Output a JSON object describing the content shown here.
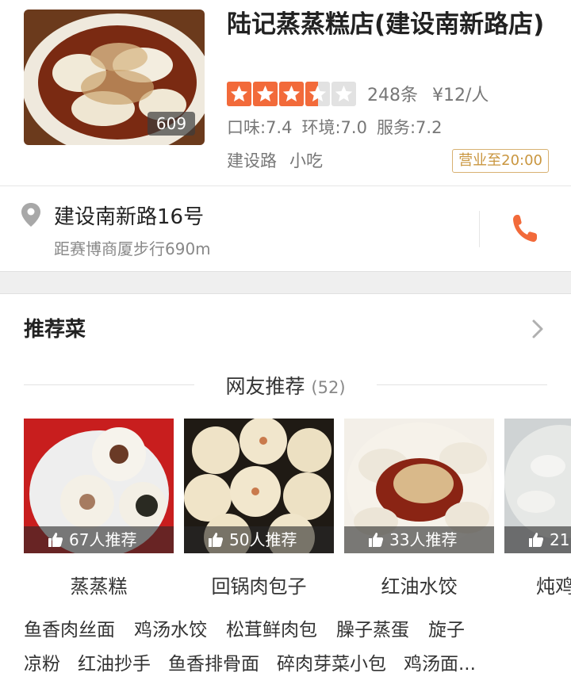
{
  "shop": {
    "name": "陆记蒸蒸糕店(建设南新路店)",
    "photo_count": "609",
    "rating": 3.5,
    "review_count": "248条",
    "avg_price": "¥12/人",
    "scores": [
      "口味:7.4",
      "环境:7.0",
      "服务:7.2"
    ],
    "tags": [
      "建设路",
      "小吃"
    ],
    "hours": "营业至20:00",
    "star_color": "#f26a3a"
  },
  "address": {
    "street": "建设南新路16号",
    "distance": "距赛博商厦步行690m",
    "phone_icon": "phone-icon",
    "accent": "#f26a3a"
  },
  "recommend": {
    "title": "推荐菜",
    "subheader": "网友推荐",
    "subheader_count": "(52)",
    "dishes": [
      {
        "name": "蒸蒸糕",
        "likes": "67人推荐"
      },
      {
        "name": "回锅肉包子",
        "likes": "50人推荐"
      },
      {
        "name": "红油水饺",
        "likes": "33人推荐"
      },
      {
        "name": "炖鸡",
        "likes": "21"
      }
    ],
    "more_row1": [
      "鱼香肉丝面",
      "鸡汤水饺",
      "松茸鲜肉包",
      "臊子蒸蛋",
      "旋子"
    ],
    "more_row2": [
      "凉粉",
      "红油抄手",
      "鱼香排骨面",
      "碎肉芽菜小包",
      "鸡汤面..."
    ]
  }
}
